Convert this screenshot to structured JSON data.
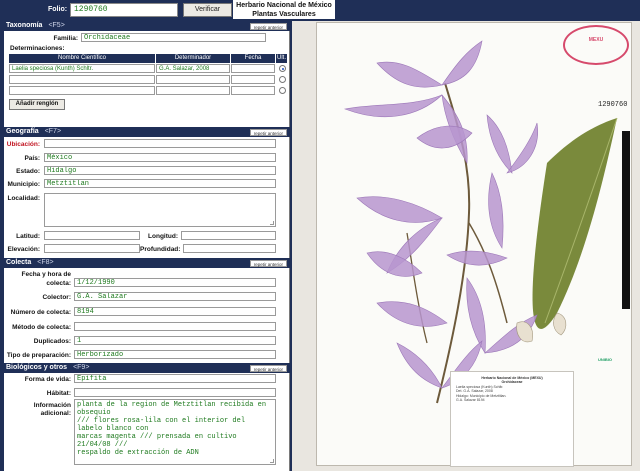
{
  "header": {
    "folio_label": "Folio:",
    "folio_value": "1290760",
    "verify_button": "Verificar",
    "herbarium_title_line1": "Herbario Nacional de México",
    "herbarium_title_line2": "Plantas Vasculares"
  },
  "taxonomia": {
    "title": "Taxonomía",
    "shortcut": "<F5>",
    "repeat": "repetir anterior",
    "familia_label": "Familia:",
    "familia_value": "Orchidaceae",
    "determinaciones_label": "Determinaciones:",
    "columns": [
      "Nombre Científico",
      "Determinador",
      "Fecha",
      "Ult."
    ],
    "rows": [
      {
        "nombre": "Laelia speciosa (Kunth) Schltr.",
        "determinador": "G.A. Salazar, 2008",
        "fecha": "",
        "selected": true
      },
      {
        "nombre": "",
        "determinador": "",
        "fecha": "",
        "selected": false
      },
      {
        "nombre": "",
        "determinador": "",
        "fecha": "",
        "selected": false
      }
    ],
    "add_row_button": "Añadir renglón"
  },
  "geografia": {
    "title": "Geografía",
    "shortcut": "<F7>",
    "repeat": "repetir anterior",
    "ubicacion_label": "Ubicación:",
    "ubicacion_value": "",
    "pais_label": "País:",
    "pais_value": "México",
    "estado_label": "Estado:",
    "estado_value": "Hidalgo",
    "municipio_label": "Municipio:",
    "municipio_value": "Metztitlan",
    "localidad_label": "Localidad:",
    "localidad_value": "",
    "latitud_label": "Latitud:",
    "latitud_value": "",
    "longitud_label": "Longitud:",
    "longitud_value": "",
    "elevacion_label": "Elevación:",
    "elevacion_value": "",
    "profundidad_label": "Profundidad:",
    "profundidad_value": ""
  },
  "colecta": {
    "title": "Colecta",
    "shortcut": "<F8>",
    "repeat": "repetir anterior",
    "fecha_label_1": "Fecha y hora de",
    "fecha_label_2": "colecta:",
    "fecha_value": "1/12/1990",
    "colector_label": "Colector:",
    "colector_value": "G.A. Salazar",
    "numero_label": "Número de colecta:",
    "numero_value": "8194",
    "metodo_label": "Método de colecta:",
    "metodo_value": "",
    "duplicados_label": "Duplicados:",
    "duplicados_value": "1",
    "preparacion_label": "Tipo de preparación:",
    "preparacion_value": "Herborizado"
  },
  "biologicos": {
    "title": "Biológicos y otros",
    "shortcut": "<F9>",
    "repeat": "repetir anterior",
    "forma_label": "Forma de vida:",
    "forma_value": "Epífita",
    "habitat_label": "Hábitat:",
    "habitat_value": "",
    "info_label_1": "Información",
    "info_label_2": "adicional:",
    "info_line1": "planta de la region de Metztitlan recibida en obsequio",
    "info_line2": "/// flores rosa-lila con el interior del labelo blanco con",
    "info_line3": "marcas magenta /// prensada en cultivo 21/04/08 ///",
    "info_line4": "respaldo de extracción de ADN"
  },
  "specimen": {
    "accession_number": "1290760",
    "stamp_line1": "MEXU",
    "label_title": "Herbario Nacional de México (MEXU)",
    "label_family": "Orchidaceae",
    "label_taxon": "Laelia speciosa (Kunth) Schltr.",
    "label_det": "Det. G.A. Salazar, 2008",
    "label_locality": "Hidalgo: Municipio de Metztitlan.",
    "label_collector": "G.A. Salazar 8194",
    "label_logo": "UNIBIO"
  }
}
